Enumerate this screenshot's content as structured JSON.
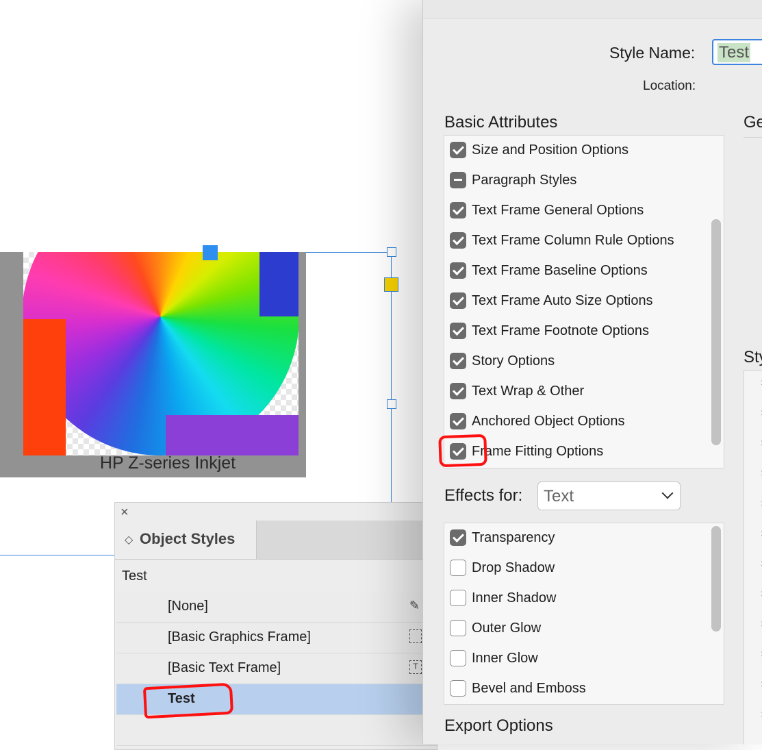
{
  "canvas": {
    "image_caption": "HP Z-series Inkjet"
  },
  "object_styles_panel": {
    "close_glyph": "×",
    "tab_arrows": "◇",
    "title": "Object Styles",
    "current_style": "Test",
    "items": [
      {
        "label": "[None]",
        "icon": "eraser-pen-icon"
      },
      {
        "label": "[Basic Graphics Frame]",
        "icon": "graphics-frame-icon"
      },
      {
        "label": "[Basic Text Frame]",
        "icon": "text-frame-icon"
      },
      {
        "label": "Test",
        "icon": ""
      }
    ],
    "selected_index": 3
  },
  "dialog": {
    "style_name_label": "Style Name:",
    "style_name_value": "Test",
    "location_label": "Location:",
    "basic_attributes_heading": "Basic Attributes",
    "general_heading": "Ge",
    "styles_heading": "Sty",
    "basic_attributes": [
      {
        "label": "Size and Position Options",
        "state": "checked"
      },
      {
        "label": "Paragraph Styles",
        "state": "mixed"
      },
      {
        "label": "Text Frame General Options",
        "state": "checked"
      },
      {
        "label": "Text Frame Column Rule Options",
        "state": "checked"
      },
      {
        "label": "Text Frame Baseline Options",
        "state": "checked"
      },
      {
        "label": "Text Frame Auto Size Options",
        "state": "checked"
      },
      {
        "label": "Text Frame Footnote Options",
        "state": "checked"
      },
      {
        "label": "Story Options",
        "state": "checked"
      },
      {
        "label": "Text Wrap & Other",
        "state": "checked"
      },
      {
        "label": "Anchored Object Options",
        "state": "checked"
      },
      {
        "label": "Frame Fitting Options",
        "state": "checked"
      }
    ],
    "effects_for_label": "Effects for:",
    "effects_for_value": "Text",
    "effects": [
      {
        "label": "Transparency",
        "state": "checked"
      },
      {
        "label": "Drop Shadow",
        "state": "unchecked"
      },
      {
        "label": "Inner Shadow",
        "state": "unchecked"
      },
      {
        "label": "Outer Glow",
        "state": "unchecked"
      },
      {
        "label": "Inner Glow",
        "state": "unchecked"
      },
      {
        "label": "Bevel and Emboss",
        "state": "unchecked"
      }
    ],
    "export_options_heading": "Export Options",
    "styles_x_marks": [
      "×",
      "×",
      "×",
      "×",
      "×",
      "×",
      "×",
      "×",
      "×",
      "×",
      "×",
      "×"
    ]
  },
  "colors": {
    "accent": "#3b84e0",
    "selection": "#b8d0ee",
    "annotation": "#ff1010"
  }
}
